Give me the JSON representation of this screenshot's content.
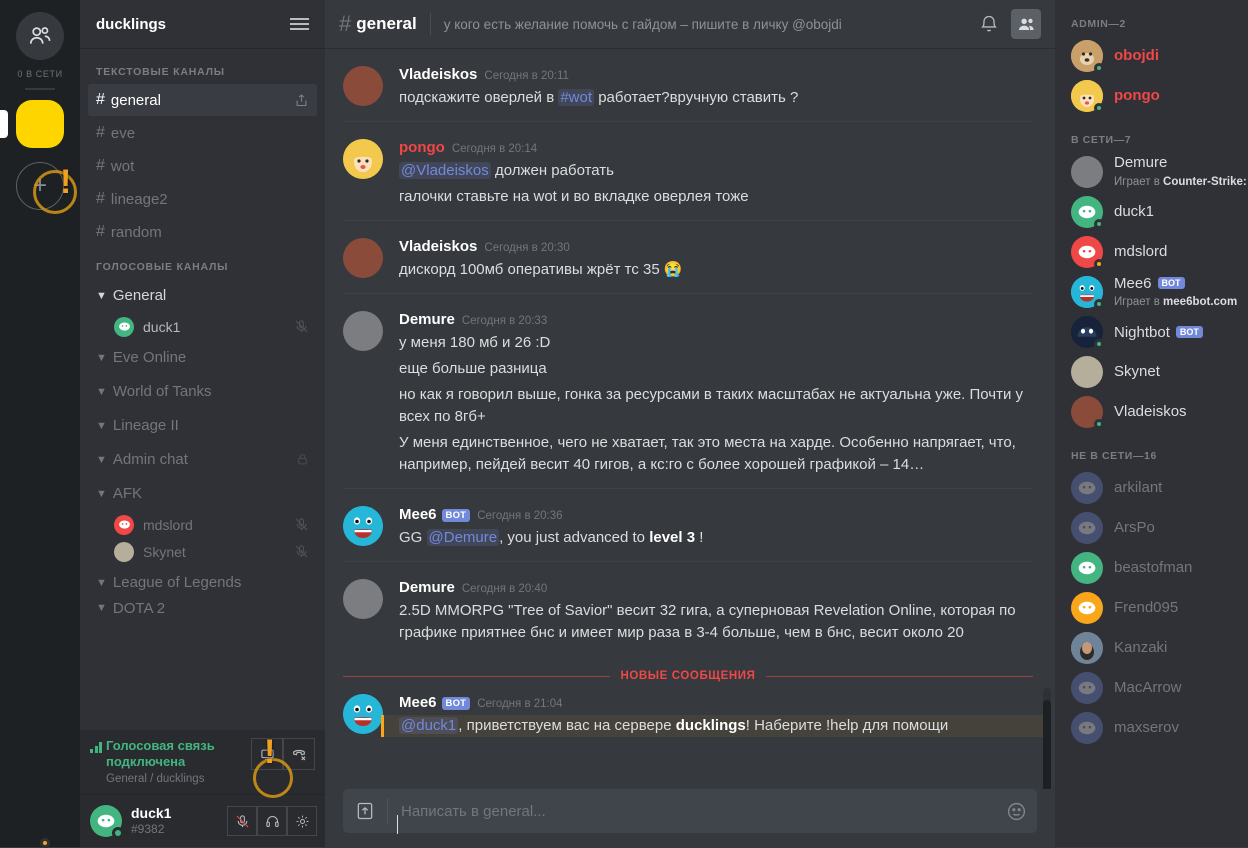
{
  "rail": {
    "dm_icon": "friends-icon",
    "online_label": "0 В СЕТИ",
    "add_server_label": "+"
  },
  "sidebar": {
    "guild_name": "ducklings",
    "menu_icon": "hamburger-icon",
    "text_category": "ТЕКСТОВЫЕ КАНАЛЫ",
    "text_channels": [
      {
        "name": "general",
        "active": true,
        "invite_icon": "invite-icon"
      },
      {
        "name": "eve",
        "active": false
      },
      {
        "name": "wot",
        "active": false
      },
      {
        "name": "lineage2",
        "active": false
      },
      {
        "name": "random",
        "active": false
      }
    ],
    "voice_category": "ГОЛОСОВЫЕ КАНАЛЫ",
    "voice_channels": [
      {
        "name": "General",
        "lit": true,
        "users": [
          {
            "name": "duck1",
            "color": "#43b581",
            "muted": true,
            "lit": true
          }
        ]
      },
      {
        "name": "Eve Online",
        "lit": false,
        "users": []
      },
      {
        "name": "World of Tanks",
        "lit": false,
        "users": []
      },
      {
        "name": "Lineage II",
        "lit": false,
        "users": []
      },
      {
        "name": "Admin chat",
        "lit": false,
        "locked": true,
        "users": []
      },
      {
        "name": "AFK",
        "lit": false,
        "users": [
          {
            "name": "mdslord",
            "color": "#f04747",
            "muted": true,
            "lit": false
          },
          {
            "name": "Skynet",
            "color": "#b4ae9a",
            "muted": true,
            "lit": false
          }
        ]
      },
      {
        "name": "League of Legends",
        "lit": false,
        "users": []
      },
      {
        "name": "DOTA 2",
        "lit": false,
        "users": []
      }
    ],
    "voice_panel": {
      "title": "Голосовая связь подключена",
      "subtitle": "General / ducklings",
      "signal_icon": "signal-icon",
      "screenshare_icon": "screenshare-icon",
      "disconnect_icon": "disconnect-icon"
    },
    "user_panel": {
      "name": "duck1",
      "tag": "#9382",
      "mute_icon": "mic-muted-icon",
      "deafen_icon": "headphones-icon",
      "settings_icon": "gear-icon"
    }
  },
  "chat": {
    "hash": "#",
    "channel": "general",
    "topic": "у кого есть желание помочь с гайдом – пишите в личку @obojdi",
    "bell_icon": "bell-icon",
    "members_icon": "members-icon",
    "new_messages_label": "НОВЫЕ СООБЩЕНИЯ",
    "composer": {
      "upload_icon": "upload-icon",
      "placeholder": "Написать в general...",
      "emoji_icon": "emoji-icon"
    },
    "messages": [
      {
        "author": "Vladeiskos",
        "time": "Сегодня в 20:11",
        "avatar": "#8a4b3a",
        "name_color": "#ffffff",
        "bot": false,
        "divided": false,
        "lines": [
          [
            {
              "t": "подскажите оверлей в ",
              "s": "plain"
            },
            {
              "t": "#wot",
              "s": "mention"
            },
            {
              "t": "  работает?вручную ставить ?",
              "s": "plain"
            }
          ]
        ]
      },
      {
        "author": "pongo",
        "time": "Сегодня в 20:14",
        "avatar": "#e8b84b",
        "name_color": "#f04747",
        "bot": false,
        "divided": true,
        "lines": [
          [
            {
              "t": "@Vladeiskos",
              "s": "mention"
            },
            {
              "t": " должен работать",
              "s": "plain"
            }
          ],
          [
            {
              "t": "галочки ставьте на wot и во вкладке оверлея тоже",
              "s": "plain"
            }
          ]
        ]
      },
      {
        "author": "Vladeiskos",
        "time": "Сегодня в 20:30",
        "avatar": "#8a4b3a",
        "name_color": "#ffffff",
        "bot": false,
        "divided": true,
        "lines": [
          [
            {
              "t": "дискорд 100мб оперативы жрёт тс 35 😭",
              "s": "plain"
            }
          ]
        ]
      },
      {
        "author": "Demure",
        "time": "Сегодня в 20:33",
        "avatar": "#7b7d80",
        "name_color": "#ffffff",
        "bot": false,
        "divided": true,
        "lines": [
          [
            {
              "t": "у меня 180 мб и 26 :D",
              "s": "plain"
            }
          ],
          [
            {
              "t": "еще больше разница",
              "s": "plain"
            }
          ],
          [
            {
              "t": "но как я говорил выше, гонка за ресурсами в таких масштабах не актуальна уже. Почти у всех по 8гб+",
              "s": "plain"
            }
          ],
          [
            {
              "t": "У меня единственное, чего не хватает, так это места на харде. Особенно напрягает, что, например, пейдей весит 40 гигов, а кс:го с более хорошей графикой – 14…",
              "s": "plain"
            }
          ]
        ]
      },
      {
        "author": "Mee6",
        "time": "Сегодня в 20:36",
        "avatar": "#1ab7d4",
        "name_color": "#ffffff",
        "bot": true,
        "bot_tag": "BOT",
        "divided": true,
        "lines": [
          [
            {
              "t": "GG ",
              "s": "plain"
            },
            {
              "t": "@Demure",
              "s": "mention"
            },
            {
              "t": ", you just advanced to ",
              "s": "plain"
            },
            {
              "t": "level 3",
              "s": "bold"
            },
            {
              "t": " !",
              "s": "plain"
            }
          ]
        ]
      },
      {
        "author": "Demure",
        "time": "Сегодня в 20:40",
        "avatar": "#7b7d80",
        "name_color": "#ffffff",
        "bot": false,
        "divided": true,
        "lines": [
          [
            {
              "t": "2.5D MMORPG \"Tree of Savior\" весит 32 гига, а суперновая Revelation Online, которая по графике приятнее бнс и имеет мир раза в 3-4 больше, чем в бнс, весит около 20",
              "s": "plain"
            }
          ]
        ]
      },
      {
        "author": "Mee6",
        "time": "Сегодня в 21:04",
        "avatar": "#1ab7d4",
        "name_color": "#ffffff",
        "bot": true,
        "bot_tag": "BOT",
        "divided": false,
        "highlight": true,
        "lines": [
          [
            {
              "t": "@duck1",
              "s": "mention"
            },
            {
              "t": ", приветствуем вас на сервере ",
              "s": "plain"
            },
            {
              "t": "ducklings",
              "s": "bold"
            },
            {
              "t": "! Наберите !help для помощи",
              "s": "plain"
            }
          ]
        ]
      }
    ]
  },
  "members": {
    "groups": [
      {
        "title": "ADMIN—2",
        "rows": [
          {
            "name": "obojdi",
            "color_class": "admin",
            "avatar": "#c89a5b",
            "status": "#43b581",
            "bot": false
          },
          {
            "name": "pongo",
            "color_class": "admin",
            "avatar": "#e8b84b",
            "status": "#43b581",
            "bot": false
          }
        ]
      },
      {
        "title": "В СЕТИ—7",
        "rows": [
          {
            "name": "Demure",
            "color_class": "online",
            "avatar": "#7b7d80",
            "status": "#43b581",
            "bot": false,
            "activity_prefix": "Играет в ",
            "activity_bold": "Counter-Strike: Gl…"
          },
          {
            "name": "duck1",
            "color_class": "online",
            "avatar": "#43b581",
            "status": "#43b581",
            "bot": false
          },
          {
            "name": "mdslord",
            "color_class": "online",
            "avatar": "#f04747",
            "status": "#faa61a",
            "bot": false
          },
          {
            "name": "Mee6",
            "color_class": "online",
            "avatar": "#1ab7d4",
            "status": "#43b581",
            "bot": true,
            "bot_tag": "BOT",
            "activity_prefix": "Играет в ",
            "activity_bold": "mee6bot.com"
          },
          {
            "name": "Nightbot",
            "color_class": "online",
            "avatar": "#1c2b45",
            "status": "#43b581",
            "bot": true,
            "bot_tag": "BOT"
          },
          {
            "name": "Skynet",
            "color_class": "online",
            "avatar": "#b4ae9a",
            "status": "#faa61a",
            "bot": false
          },
          {
            "name": "Vladeiskos",
            "color_class": "online",
            "avatar": "#8a4b3a",
            "status": "#43b581",
            "bot": false
          }
        ]
      },
      {
        "title": "НЕ В СЕТИ—16",
        "rows": [
          {
            "name": "arkilant",
            "color_class": "offline",
            "avatar": "#7289da",
            "offline": true,
            "bot": false
          },
          {
            "name": "ArsPo",
            "color_class": "offline",
            "avatar": "#7289da",
            "offline": true,
            "bot": false
          },
          {
            "name": "beastofman",
            "color_class": "offline",
            "avatar": "#43b581",
            "offline": true,
            "bot": false
          },
          {
            "name": "Frend095",
            "color_class": "offline",
            "avatar": "#faa61a",
            "offline": true,
            "bot": false
          },
          {
            "name": "Kanzaki",
            "color_class": "offline",
            "avatar": "#5a6b80",
            "offline": true,
            "bot": false
          },
          {
            "name": "MacArrow",
            "color_class": "offline",
            "avatar": "#7289da",
            "offline": true,
            "bot": false
          },
          {
            "name": "maxserov",
            "color_class": "offline",
            "avatar": "#7289da",
            "offline": true,
            "bot": false
          }
        ]
      }
    ]
  }
}
